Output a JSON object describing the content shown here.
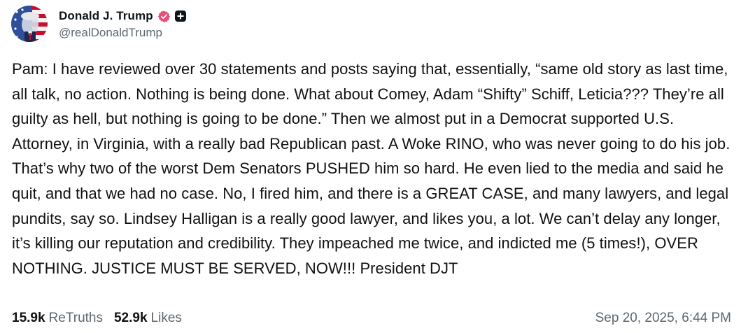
{
  "header": {
    "display_name": "Donald J. Trump",
    "handle": "@realDonaldTrump",
    "colors": {
      "verified_badge": "#e8507a",
      "plus_badge": "#0f1419"
    }
  },
  "post": {
    "text": "Pam: I have reviewed over 30 statements and posts saying that, essentially, “same old story as last time, all talk, no action. Nothing is being done. What about Comey, Adam “Shifty” Schiff, Leticia??? They’re all guilty as hell, but nothing is going to be done.” Then we almost put in a Democrat supported U.S. Attorney, in Virginia, with a really bad Republican past. A Woke RINO, who was never going to do his job. That’s why two of the worst Dem Senators PUSHED him so hard. He even lied to the media and said he quit, and that we had no case. No, I fired him, and there is a GREAT CASE, and many lawyers, and legal pundits, say so. Lindsey Halligan is a really good lawyer, and likes you, a lot. We can’t delay any longer, it’s killing our reputation and credibility. They impeached me twice, and indicted me (5 times!), OVER NOTHING. JUSTICE MUST BE SERVED, NOW!!! President DJT"
  },
  "footer": {
    "retruths_count": "15.9k",
    "retruths_label": "ReTruths",
    "likes_count": "52.9k",
    "likes_label": "Likes",
    "timestamp": "Sep 20, 2025, 6:44 PM"
  }
}
